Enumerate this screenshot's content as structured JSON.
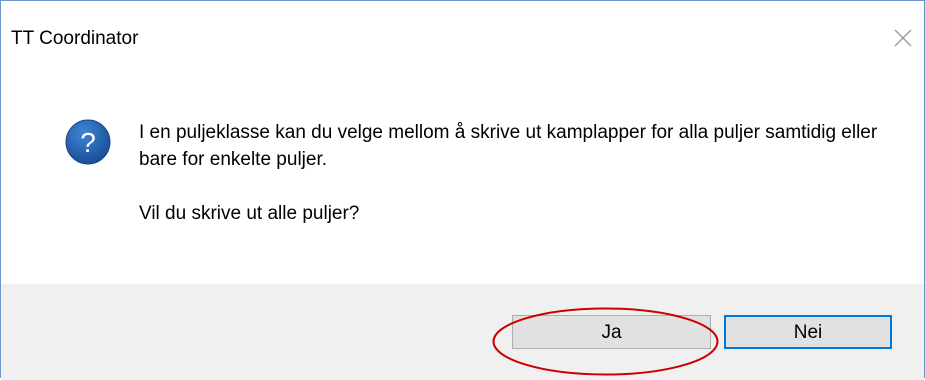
{
  "window": {
    "title": "TT Coordinator",
    "close_icon": "close-icon"
  },
  "message": {
    "icon": "question-icon",
    "paragraph1": "I en puljeklasse kan du velge mellom å skrive ut kamplapper for alla puljer samtidig eller bare for enkelte puljer.",
    "paragraph2": "Vil du skrive ut alle puljer?"
  },
  "buttons": {
    "yes_label": "Ja",
    "no_label": "Nei",
    "default": "Nei"
  },
  "colors": {
    "accent": "#0078d7",
    "icon_blue": "#1c5aa6",
    "annotation": "#cc0000",
    "footer_bg": "#f0f0f0"
  }
}
